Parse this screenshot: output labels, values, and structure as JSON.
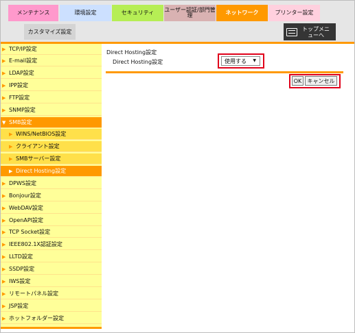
{
  "header": {
    "tabs": [
      {
        "label": "メンテナンス"
      },
      {
        "label": "環境設定"
      },
      {
        "label": "セキュリティ"
      },
      {
        "label": "ユーザー認証/部門管理"
      },
      {
        "label": "ネットワーク"
      },
      {
        "label": "プリンター設定"
      }
    ],
    "custom_tab": "カスタマイズ設定",
    "top_menu": "トップメニューへ",
    "top_menu_icon": "menu-list-icon"
  },
  "sidebar": {
    "items": [
      {
        "label": "TCP/IP設定"
      },
      {
        "label": "E-mail設定"
      },
      {
        "label": "LDAP設定"
      },
      {
        "label": "IPP設定"
      },
      {
        "label": "FTP設定"
      },
      {
        "label": "SNMP設定"
      },
      {
        "label": "SMB設定"
      },
      {
        "label": "WINS/NetBIOS設定"
      },
      {
        "label": "クライアント設定"
      },
      {
        "label": "SMBサーバー設定"
      },
      {
        "label": "Direct Hosting設定"
      },
      {
        "label": "DPWS設定"
      },
      {
        "label": "Bonjour設定"
      },
      {
        "label": "WebDAV設定"
      },
      {
        "label": "OpenAPI設定"
      },
      {
        "label": "TCP Socket設定"
      },
      {
        "label": "IEEE802.1X認証設定"
      },
      {
        "label": "LLTD設定"
      },
      {
        "label": "SSDP設定"
      },
      {
        "label": "IWS設定"
      },
      {
        "label": "リモートパネル設定"
      },
      {
        "label": "JSP設定"
      },
      {
        "label": "ホットフォルダー設定"
      }
    ]
  },
  "main": {
    "section_title": "Direct Hosting設定",
    "field_label": "Direct Hosting設定",
    "select_value": "使用する",
    "ok_label": "OK",
    "cancel_label": "キャンセル"
  },
  "colors": {
    "accent": "#ff9900",
    "sidebar_bg": "#ffff99",
    "highlight": "#e0001a"
  }
}
